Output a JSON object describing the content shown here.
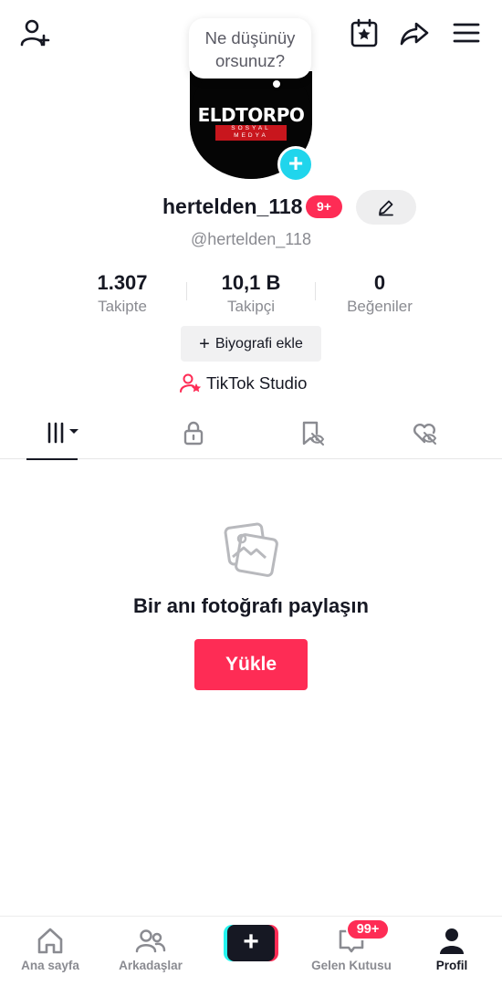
{
  "top_bar": {
    "add_friend_icon": "person-plus-icon",
    "calendar_icon": "calendar-star-icon",
    "share_icon": "share-arrow-icon",
    "menu_icon": "hamburger-menu-icon"
  },
  "thought_bubble": {
    "line1": "Ne düşünüy",
    "line2": "orsunuz?"
  },
  "avatar": {
    "logo_text": "ELDTORPO",
    "logo_sub": "SOSYAL MEDYA",
    "add_icon": "+"
  },
  "profile": {
    "username": "hertelden_118",
    "badge": "9+",
    "handle": "@hertelden_118"
  },
  "stats": [
    {
      "value": "1.307",
      "label": "Takipte"
    },
    {
      "value": "10,1 B",
      "label": "Takipçi"
    },
    {
      "value": "0",
      "label": "Beğeniler"
    }
  ],
  "bio_button": {
    "plus": "+",
    "label": "Biyografi ekle"
  },
  "studio_link": {
    "label": "TikTok Studio"
  },
  "tabs": [
    {
      "icon": "grid-videos-icon",
      "active": true
    },
    {
      "icon": "lock-icon",
      "active": false
    },
    {
      "icon": "bookmark-eye-icon",
      "active": false
    },
    {
      "icon": "heart-eye-icon",
      "active": false
    }
  ],
  "empty_state": {
    "title": "Bir anı fotoğrafı paylaşın",
    "button": "Yükle"
  },
  "bottom_nav": {
    "home": "Ana sayfa",
    "friends": "Arkadaşlar",
    "create": "+",
    "inbox": "Gelen Kutusu",
    "inbox_badge": "99+",
    "profile": "Profil"
  },
  "colors": {
    "accent_red": "#fe2c55",
    "accent_cyan": "#20d5ec",
    "text_primary": "#161823",
    "text_secondary": "#8a8b91"
  }
}
